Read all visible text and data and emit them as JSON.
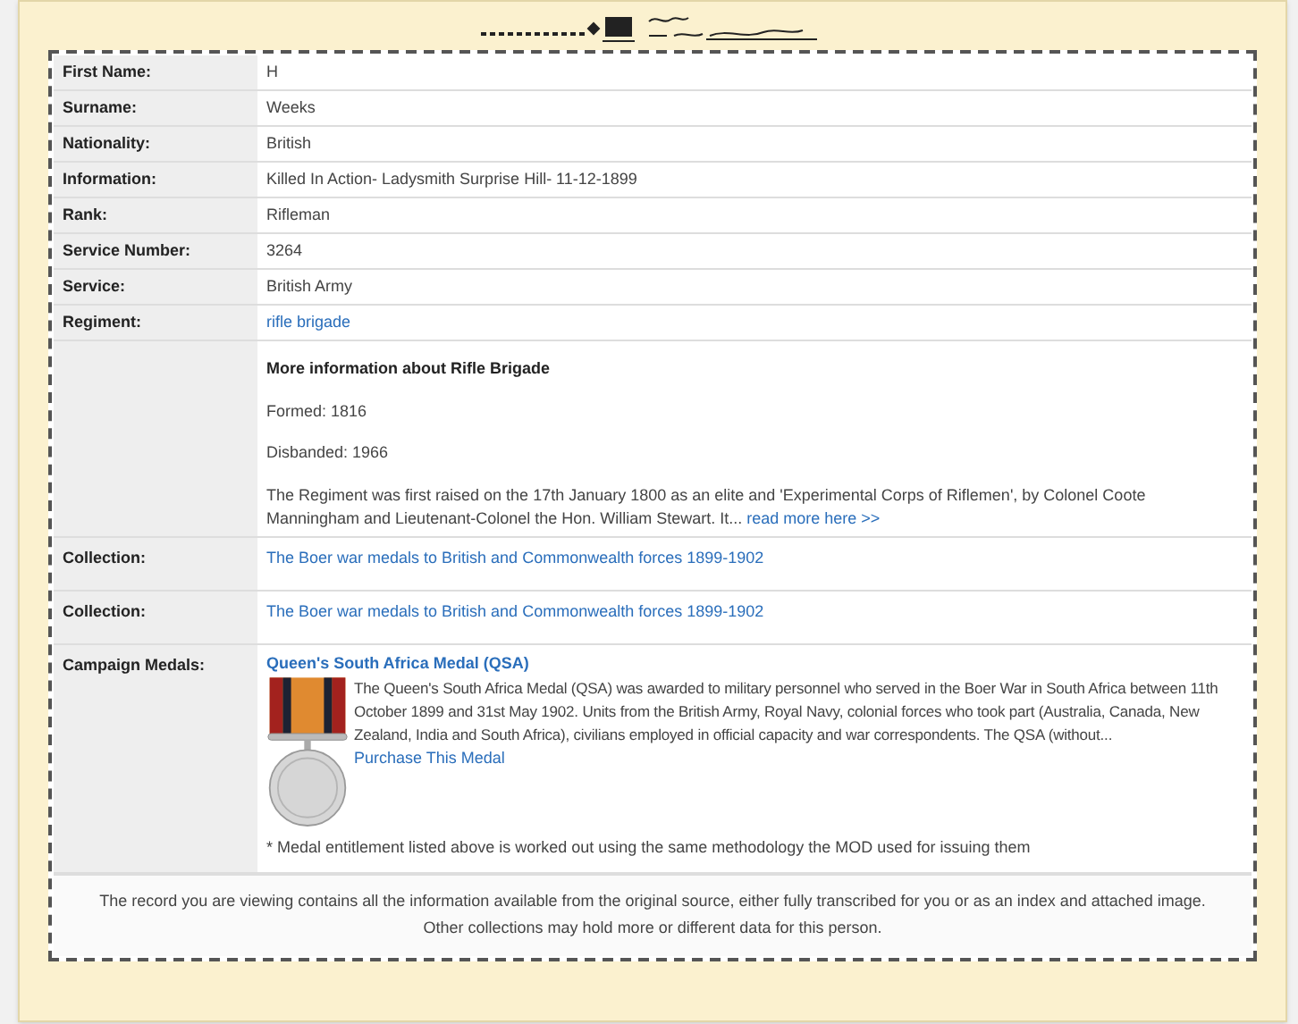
{
  "rows": [
    {
      "kind": "text",
      "label": "First Name:",
      "value": "H"
    },
    {
      "kind": "text",
      "label": "Surname:",
      "value": "Weeks"
    },
    {
      "kind": "text",
      "label": "Nationality:",
      "value": "British"
    },
    {
      "kind": "text",
      "label": "Information:",
      "value": "Killed In Action- Ladysmith Surprise Hill- 11-12-1899"
    },
    {
      "kind": "text",
      "label": "Rank:",
      "value": "Rifleman"
    },
    {
      "kind": "text",
      "label": "Service Number:",
      "value": "3264"
    },
    {
      "kind": "text",
      "label": "Service:",
      "value": "British Army"
    },
    {
      "kind": "link",
      "label": "Regiment:",
      "value": "rifle brigade"
    },
    {
      "kind": "info",
      "heading": "More information about Rifle Brigade",
      "lines": [
        "Formed: 1816",
        "Disbanded: 1966"
      ],
      "description": "The Regiment was first raised on the 17th January 1800 as an elite and 'Experimental Corps of Riflemen', by Colonel Coote Manningham and Lieutenant-Colonel the Hon. William Stewart. It...",
      "read_more": "read more here  >>"
    },
    {
      "kind": "collection",
      "label": "Collection:",
      "value": "The Boer war medals to British and Commonwealth forces 1899-1902"
    },
    {
      "kind": "collection",
      "label": "Collection:",
      "value": "The Boer war medals to British and Commonwealth forces 1899-1902"
    },
    {
      "kind": "medal",
      "label": "Campaign Medals:",
      "title": "Queen's South Africa Medal (QSA)",
      "description": "The Queen's South Africa Medal (QSA) was awarded to military personnel who served in the Boer War in South Africa between 11th October 1899 and 31st May 1902. Units from the British Army, Royal Navy, colonial forces who took part (Australia, Canada, New Zealand, India and South Africa), civilians employed in official capacity and war correspondents. The QSA (without...",
      "purchase": "Purchase This Medal",
      "note": "* Medal entitlement listed above is worked out using the same methodology the MOD used for issuing them"
    }
  ],
  "footer": [
    "The record you are viewing contains all the information available from the original source, either fully transcribed for you or as an index and attached image.",
    "Other collections may hold more or different data for this person."
  ]
}
